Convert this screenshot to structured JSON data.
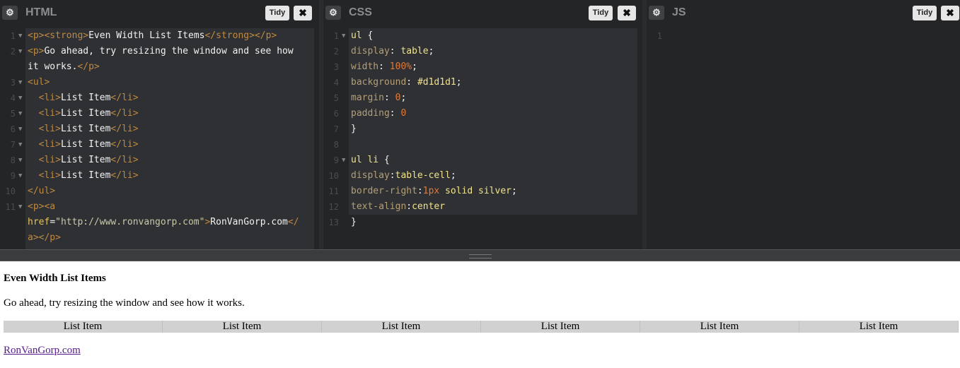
{
  "panels": {
    "html": {
      "title": "HTML",
      "tidy": "Tidy",
      "close": "✖"
    },
    "css": {
      "title": "CSS",
      "tidy": "Tidy",
      "close": "✖"
    },
    "js": {
      "title": "JS",
      "tidy": "Tidy",
      "close": "✖"
    }
  },
  "html_code": [
    {
      "n": "1",
      "fold": true,
      "parts": [
        [
          "t-tag",
          "<p>"
        ],
        [
          "t-tag",
          "<strong>"
        ],
        [
          "t-txt",
          "Even Width List Items"
        ],
        [
          "t-tag",
          "</strong>"
        ],
        [
          "t-tag",
          "</p>"
        ]
      ]
    },
    {
      "n": "2",
      "fold": true,
      "parts": [
        [
          "t-tag",
          "<p>"
        ],
        [
          "t-txt",
          "Go ahead, try resizing the window and see how"
        ]
      ]
    },
    {
      "n": "",
      "fold": false,
      "parts": [
        [
          "t-txt",
          "it works."
        ],
        [
          "t-tag",
          "</p>"
        ]
      ]
    },
    {
      "n": "3",
      "fold": true,
      "parts": [
        [
          "t-tag",
          "<ul>"
        ]
      ]
    },
    {
      "n": "4",
      "fold": true,
      "parts": [
        [
          "t-txt",
          "  "
        ],
        [
          "t-tag",
          "<li>"
        ],
        [
          "t-txt",
          "List Item"
        ],
        [
          "t-tag",
          "</li>"
        ]
      ]
    },
    {
      "n": "5",
      "fold": true,
      "parts": [
        [
          "t-txt",
          "  "
        ],
        [
          "t-tag",
          "<li>"
        ],
        [
          "t-txt",
          "List Item"
        ],
        [
          "t-tag",
          "</li>"
        ]
      ]
    },
    {
      "n": "6",
      "fold": true,
      "parts": [
        [
          "t-txt",
          "  "
        ],
        [
          "t-tag",
          "<li>"
        ],
        [
          "t-txt",
          "List Item"
        ],
        [
          "t-tag",
          "</li>"
        ]
      ]
    },
    {
      "n": "7",
      "fold": true,
      "parts": [
        [
          "t-txt",
          "  "
        ],
        [
          "t-tag",
          "<li>"
        ],
        [
          "t-txt",
          "List Item"
        ],
        [
          "t-tag",
          "</li>"
        ]
      ]
    },
    {
      "n": "8",
      "fold": true,
      "parts": [
        [
          "t-txt",
          "  "
        ],
        [
          "t-tag",
          "<li>"
        ],
        [
          "t-txt",
          "List Item"
        ],
        [
          "t-tag",
          "</li>"
        ]
      ]
    },
    {
      "n": "9",
      "fold": true,
      "parts": [
        [
          "t-txt",
          "  "
        ],
        [
          "t-tag",
          "<li>"
        ],
        [
          "t-txt",
          "List Item"
        ],
        [
          "t-tag",
          "</li>"
        ]
      ]
    },
    {
      "n": "10",
      "fold": false,
      "parts": [
        [
          "t-tag",
          "</ul>"
        ]
      ]
    },
    {
      "n": "11",
      "fold": true,
      "parts": [
        [
          "t-tag",
          "<p><a"
        ]
      ]
    },
    {
      "n": "",
      "fold": false,
      "parts": [
        [
          "t-attr",
          "href"
        ],
        [
          "t-txt",
          "="
        ],
        [
          "t-str",
          "\"http://www.ronvangorp.com\""
        ],
        [
          "t-tag",
          ">"
        ],
        [
          "t-txt",
          "RonVanGorp.com"
        ],
        [
          "t-tag",
          "</"
        ]
      ]
    },
    {
      "n": "",
      "fold": false,
      "parts": [
        [
          "t-tag",
          "a></p>"
        ]
      ]
    }
  ],
  "css_code": [
    {
      "n": "1",
      "fold": true,
      "parts": [
        [
          "c-sel",
          "ul "
        ],
        [
          "c-punc",
          "{"
        ]
      ]
    },
    {
      "n": "2",
      "fold": false,
      "parts": [
        [
          "c-prop",
          "display"
        ],
        [
          "c-punc",
          ": "
        ],
        [
          "c-val",
          "table"
        ],
        [
          "c-punc",
          ";"
        ]
      ]
    },
    {
      "n": "3",
      "fold": false,
      "parts": [
        [
          "c-prop",
          "width"
        ],
        [
          "c-punc",
          ": "
        ],
        [
          "c-num",
          "100%"
        ],
        [
          "c-punc",
          ";"
        ]
      ]
    },
    {
      "n": "4",
      "fold": false,
      "parts": [
        [
          "c-prop",
          "background"
        ],
        [
          "c-punc",
          ": "
        ],
        [
          "c-val",
          "#d1d1d1"
        ],
        [
          "c-punc",
          ";"
        ]
      ]
    },
    {
      "n": "5",
      "fold": false,
      "parts": [
        [
          "c-prop",
          "margin"
        ],
        [
          "c-punc",
          ": "
        ],
        [
          "c-num",
          "0"
        ],
        [
          "c-punc",
          ";"
        ]
      ]
    },
    {
      "n": "6",
      "fold": false,
      "parts": [
        [
          "c-prop",
          "padding"
        ],
        [
          "c-punc",
          ": "
        ],
        [
          "c-num",
          "0"
        ]
      ]
    },
    {
      "n": "7",
      "fold": false,
      "parts": [
        [
          "c-punc",
          "}"
        ]
      ]
    },
    {
      "n": "8",
      "fold": false,
      "parts": []
    },
    {
      "n": "9",
      "fold": true,
      "parts": [
        [
          "c-sel",
          "ul li "
        ],
        [
          "c-punc",
          "{"
        ]
      ]
    },
    {
      "n": "10",
      "fold": false,
      "parts": [
        [
          "c-prop",
          "display"
        ],
        [
          "c-punc",
          ":"
        ],
        [
          "c-val",
          "table-cell"
        ],
        [
          "c-punc",
          ";"
        ]
      ]
    },
    {
      "n": "11",
      "fold": false,
      "parts": [
        [
          "c-prop",
          "border-right"
        ],
        [
          "c-punc",
          ":"
        ],
        [
          "c-num",
          "1px"
        ],
        [
          "c-val",
          " solid silver"
        ],
        [
          "c-punc",
          ";"
        ]
      ]
    },
    {
      "n": "12",
      "fold": false,
      "parts": [
        [
          "c-prop",
          "text-align"
        ],
        [
          "c-punc",
          ":"
        ],
        [
          "c-val",
          "center"
        ]
      ]
    },
    {
      "n": "13",
      "fold": false,
      "parts": [
        [
          "c-punc",
          "}"
        ]
      ]
    }
  ],
  "js_code": [
    {
      "n": "1",
      "fold": false,
      "parts": []
    }
  ],
  "result": {
    "title": "Even Width List Items",
    "paragraph": "Go ahead, try resizing the window and see how it works.",
    "list_items": [
      "List Item",
      "List Item",
      "List Item",
      "List Item",
      "List Item",
      "List Item"
    ],
    "link_text": "RonVanGorp.com"
  }
}
